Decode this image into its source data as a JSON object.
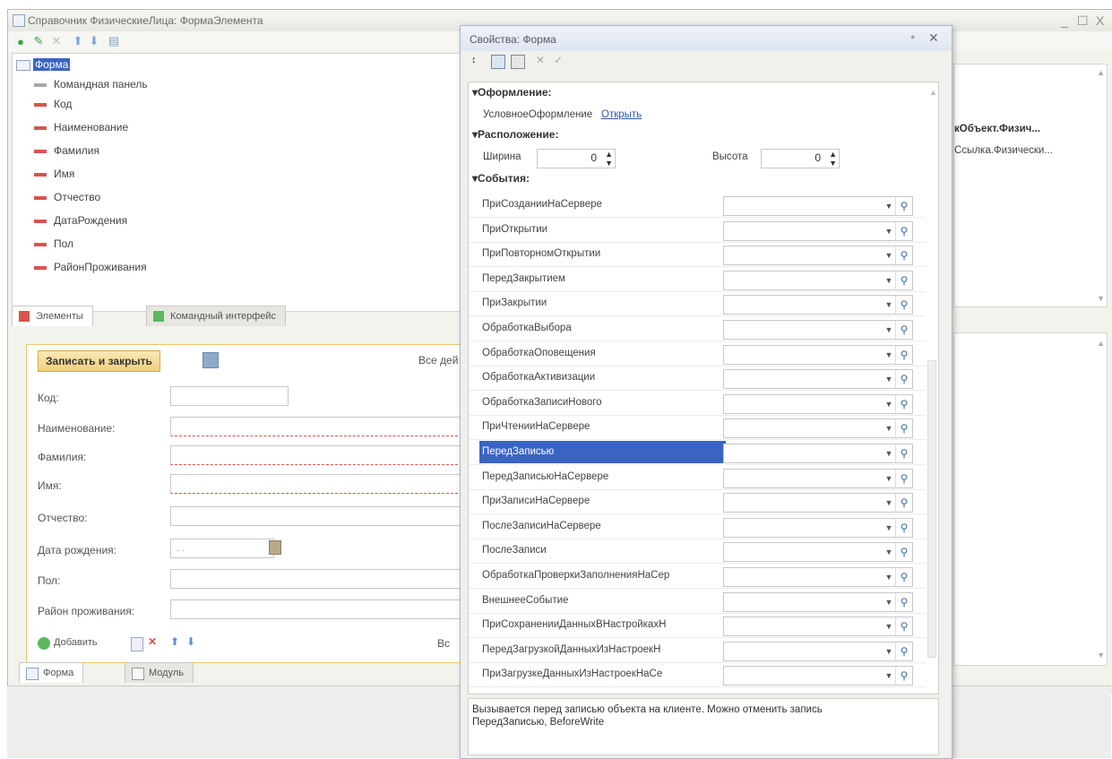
{
  "main": {
    "title": "Справочник ФизическиеЛица: ФормаЭлемента",
    "window_controls": [
      "_",
      "☐",
      "X"
    ],
    "tree": {
      "root": "Форма",
      "items": [
        "Командная панель",
        "Код",
        "Наименование",
        "Фамилия",
        "Имя",
        "Отчество",
        "ДатаРождения",
        "Пол",
        "РайонПроживания"
      ]
    },
    "tabs_top": [
      "Элементы",
      "Командный интерфейс"
    ],
    "right_col": {
      "header": "кОбъект.Физич...",
      "row": "Ссылка.Физически..."
    },
    "form": {
      "save_button": "Записать и закрыть",
      "all_actions": "Все дей",
      "fields": [
        {
          "label": "Код:",
          "value": ""
        },
        {
          "label": "Наименование:",
          "value": ""
        },
        {
          "label": "Фамилия:",
          "value": ""
        },
        {
          "label": "Имя:",
          "value": ""
        },
        {
          "label": "Отчество:",
          "value": ""
        },
        {
          "label": "Дата рождения:",
          "value": ". ."
        },
        {
          "label": "Пол:",
          "value": ""
        },
        {
          "label": "Район проживания:",
          "value": ""
        }
      ],
      "add_button": "Добавить",
      "bottom_more": "Вс"
    },
    "tabs_bottom": [
      "Форма",
      "Модуль"
    ]
  },
  "props": {
    "title": "Свойства: Форма",
    "group_design": "Оформление:",
    "conditional_label": "УсловноеОформление",
    "conditional_link": "Открыть",
    "group_layout": "Расположение:",
    "width_label": "Ширина",
    "width_value": "0",
    "height_label": "Высота",
    "height_value": "0",
    "group_events": "События:",
    "events": [
      "ПриСозданииНаСервере",
      "ПриОткрытии",
      "ПриПовторномОткрытии",
      "ПередЗакрытием",
      "ПриЗакрытии",
      "ОбработкаВыбора",
      "ОбработкаОповещения",
      "ОбработкаАктивизации",
      "ОбработкаЗаписиНового",
      "ПриЧтенииНаСервере",
      "ПередЗаписью",
      "ПередЗаписьюНаСервере",
      "ПриЗаписиНаСервере",
      "ПослеЗаписиНаСервере",
      "ПослеЗаписи",
      "ОбработкаПроверкиЗаполненияНаСер",
      "ВнешнееСобытие",
      "ПриСохраненииДанныхВНастройкахН",
      "ПередЗагрузкойДанныхИзНастроекН",
      "ПриЗагрузкеДанныхИзНастроекНаСе"
    ],
    "selected_event": "ПередЗаписью",
    "description": "Вызывается перед записью объекта на клиенте. Можно отменить запись",
    "description2": "ПередЗаписью, BeforeWrite"
  },
  "colors": {
    "selection": "#3a64c4",
    "required": "#d9534f",
    "accent": "#f1cf7c"
  }
}
